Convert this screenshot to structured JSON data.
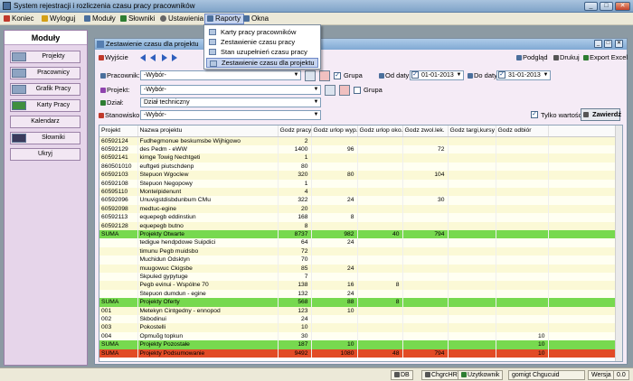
{
  "window": {
    "title": "System rejestracji i rozliczenia czasu pracy pracowników",
    "controls": [
      "_",
      "□",
      "✕"
    ]
  },
  "menu": [
    {
      "label": "Koniec",
      "color": "#c0392b"
    },
    {
      "label": "Wyloguj",
      "color": "#d4a017"
    },
    {
      "label": "Moduły",
      "color": "#4b6f9c"
    },
    {
      "label": "Słowniki",
      "color": "#2e7d32"
    },
    {
      "label": "Ustawienia",
      "color": "#666666"
    },
    {
      "label": "Raporty",
      "color": "#4b6f9c"
    },
    {
      "label": "Okna",
      "color": "#4b6f9c"
    }
  ],
  "raporty_dropdown": [
    "Karty pracy pracowników",
    "Zestawienie czasu pracy",
    "Stan uzupełnień czasu pracy",
    "Zestawienie czasu dla projektu"
  ],
  "sidebar": {
    "header": "Moduły",
    "items": [
      "Projekty",
      "Pracownicy",
      "Grafik Pracy",
      "Karty Pracy",
      "Kalendarz",
      "Słowniki",
      "Ukryj"
    ]
  },
  "panel": {
    "title": "Zestawienie czasu dla projektu",
    "controls": [
      "_",
      "□",
      "✕"
    ],
    "toolbar": {
      "exit": "Wyjście",
      "preview": "Podgląd",
      "print": "Drukuj",
      "export": "Export Excel"
    },
    "filters": {
      "employee_label": "Pracownik:",
      "employee_value": "-Wybór-",
      "group_label": "Grupa",
      "group_checked": true,
      "date_from_label": "Od daty:",
      "date_from": "01-01-2013",
      "date_to_label": "Do daty:",
      "date_to": "31-01-2013",
      "project_label": "Projekt:",
      "project_value": "-Wybór-",
      "group2_label": "Grupa",
      "group2_checked": false,
      "dept_label": "Dział:",
      "dept_value": "Dział techniczny",
      "position_label": "Stanowisko:",
      "position_value": "-Wybór-",
      "only_values_label": "Tylko wartości",
      "only_values_checked": true,
      "confirm_label": "Zawierdź"
    }
  },
  "table": {
    "columns": [
      "Projekt",
      "Nazwa projektu",
      "Godz pracy",
      "Godz urlop wyp.",
      "Godz urlop oko.",
      "Godz zwol.lek.",
      "Godz targi,kursy",
      "Godz odbiór"
    ],
    "rows": [
      {
        "type": "odd",
        "cells": [
          "60592124",
          "Fudhegmonue beskumsbe Wijhigowo",
          "2",
          "",
          "",
          "",
          "",
          ""
        ]
      },
      {
        "type": "even",
        "cells": [
          "60592129",
          "des Pedm - eWW",
          "1400",
          "96",
          "",
          "72",
          "",
          ""
        ]
      },
      {
        "type": "odd",
        "cells": [
          "60592141",
          "kimge Towig Nechtgeti",
          "1",
          "",
          "",
          "",
          "",
          ""
        ]
      },
      {
        "type": "even",
        "cells": [
          "860501010",
          "euftgeti piutschdenp",
          "80",
          "",
          "",
          "",
          "",
          ""
        ]
      },
      {
        "type": "odd",
        "cells": [
          "60592103",
          "Stepuon Wgoclew",
          "320",
          "80",
          "",
          "104",
          "",
          ""
        ]
      },
      {
        "type": "even",
        "cells": [
          "60592108",
          "Stepuon Negopowy",
          "1",
          "",
          "",
          "",
          "",
          ""
        ]
      },
      {
        "type": "odd",
        "cells": [
          "60595110",
          "Montelpidenunt",
          "4",
          "",
          "",
          "",
          "",
          ""
        ]
      },
      {
        "type": "even",
        "cells": [
          "60592096",
          "Unuvigstdisbdunbum CMu",
          "322",
          "24",
          "",
          "30",
          "",
          ""
        ]
      },
      {
        "type": "odd",
        "cells": [
          "60592098",
          "medtuc-egine",
          "20",
          "",
          "",
          "",
          "",
          ""
        ]
      },
      {
        "type": "even",
        "cells": [
          "60592113",
          "equepegb eddinstiun",
          "168",
          "8",
          "",
          "",
          "",
          ""
        ]
      },
      {
        "type": "odd",
        "cells": [
          "60592128",
          "equepegb butno",
          "8",
          "",
          "",
          "",
          "",
          ""
        ]
      },
      {
        "type": "sum-green",
        "cells": [
          "SUMA",
          "Projekty Otwarte",
          "8737",
          "982",
          "40",
          "794",
          "",
          ""
        ]
      },
      {
        "type": "even",
        "cells": [
          "",
          "tedigue hendpdowe Suipdici",
          "64",
          "24",
          "",
          "",
          "",
          ""
        ]
      },
      {
        "type": "odd",
        "cells": [
          "",
          "timunu Pegb muidsbo",
          "72",
          "",
          "",
          "",
          "",
          ""
        ]
      },
      {
        "type": "even",
        "cells": [
          "",
          "Muchidun Odsktyn",
          "70",
          "",
          "",
          "",
          "",
          ""
        ]
      },
      {
        "type": "odd",
        "cells": [
          "",
          "muugowuc Ckigsbe",
          "85",
          "24",
          "",
          "",
          "",
          ""
        ]
      },
      {
        "type": "even",
        "cells": [
          "",
          "Skpuled gypytuge",
          "7",
          "",
          "",
          "",
          "",
          ""
        ]
      },
      {
        "type": "odd",
        "cells": [
          "",
          "Pegb evinui - Wspólne 70",
          "138",
          "16",
          "8",
          "",
          "",
          ""
        ]
      },
      {
        "type": "even",
        "cells": [
          "",
          "Stepuon dumdun - egine",
          "132",
          "24",
          "",
          "",
          "",
          ""
        ]
      },
      {
        "type": "sum-green",
        "cells": [
          "SUMA",
          "Projekty Oferty",
          "568",
          "88",
          "8",
          "",
          "",
          ""
        ]
      },
      {
        "type": "odd",
        "cells": [
          "001",
          "Metekyn Cintgedny - ennopod",
          "123",
          "10",
          "",
          "",
          "",
          ""
        ]
      },
      {
        "type": "even",
        "cells": [
          "002",
          "Skbodinui",
          "24",
          "",
          "",
          "",
          "",
          ""
        ]
      },
      {
        "type": "odd",
        "cells": [
          "003",
          "Pokostelli",
          "10",
          "",
          "",
          "",
          "",
          ""
        ]
      },
      {
        "type": "even",
        "cells": [
          "004",
          "Opmuõg topkun",
          "30",
          "",
          "",
          "",
          "",
          "10"
        ]
      },
      {
        "type": "sum-green",
        "cells": [
          "SUMA",
          "Projekty Pozostałe",
          "187",
          "10",
          "",
          "",
          "",
          "10"
        ]
      },
      {
        "type": "sum-red",
        "cells": [
          "SUMA",
          "Projekty Podsumowanie",
          "9492",
          "1080",
          "48",
          "794",
          "",
          "10"
        ]
      }
    ]
  },
  "status": {
    "db_label": "DB",
    "db_value": "ChgrcHR",
    "user_label": "Uzytkownik",
    "user_value": "gomigt Chgucuid",
    "version_label": "Wersja",
    "version_value": "0.0"
  }
}
